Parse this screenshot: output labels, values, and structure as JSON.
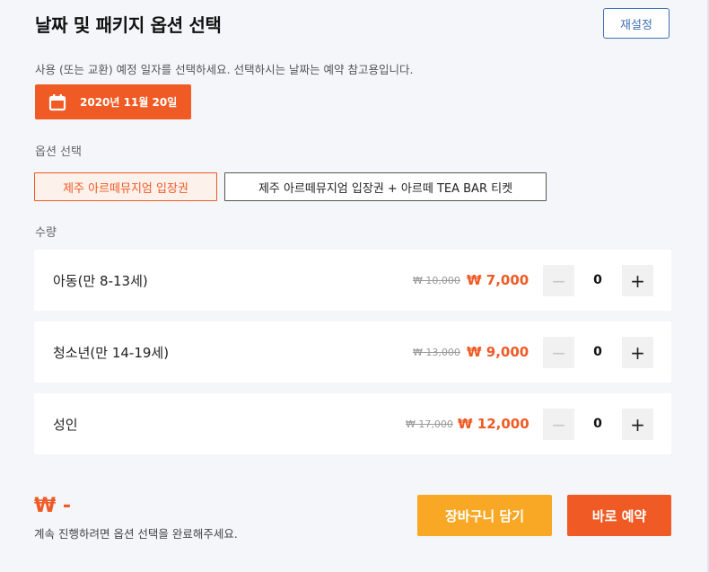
{
  "header": {
    "title": "날짜 및 패키지 옵션 선택",
    "reset_label": "재설정"
  },
  "date_section": {
    "description": "사용 (또는 교환) 예정 일자를 선택하세요. 선택하시는 날짜는 예약 참고용입니다.",
    "selected_date": "2020년 11월 20일",
    "icon": "calendar-icon"
  },
  "options": {
    "label": "옵션 선택",
    "items": [
      {
        "label": "제주 아르떼뮤지엄 입장권",
        "selected": true
      },
      {
        "label": "제주 아르떼뮤지엄 입장권 + 아르떼 TEA BAR 티켓",
        "selected": false
      }
    ]
  },
  "quantity": {
    "label": "수량",
    "rows": [
      {
        "name": "아동(만 8-13세)",
        "original_price": "₩ 10,000",
        "price": "₩ 7,000",
        "qty": "0",
        "minus": "−",
        "plus": "+"
      },
      {
        "name": "청소년(만 14-19세)",
        "original_price": "₩ 13,000",
        "price": "₩ 9,000",
        "qty": "0",
        "minus": "−",
        "plus": "+"
      },
      {
        "name": "성인",
        "original_price": "₩ 17,000",
        "price": "₩ 12,000",
        "qty": "0",
        "minus": "−",
        "plus": "+"
      }
    ]
  },
  "footer": {
    "total": "₩ -",
    "hint": "계속 진행하려면 옵션 선택을 완료해주세요.",
    "cart_label": "장바구니 담기",
    "book_label": "바로 예약"
  },
  "colors": {
    "accent": "#f05a24",
    "cart": "#f9a825",
    "link": "#3f6fb3"
  }
}
